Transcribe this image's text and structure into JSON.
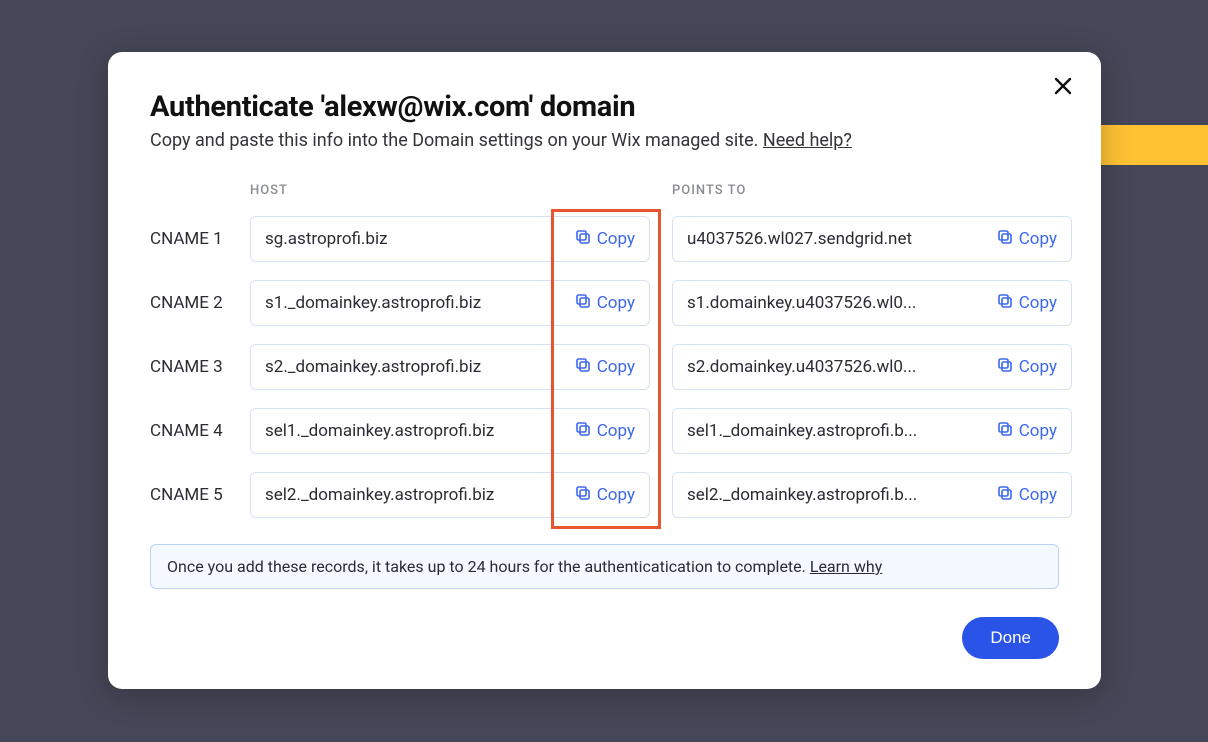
{
  "modal": {
    "title": "Authenticate 'alexw@wix.com' domain",
    "subtitle_prefix": "Copy and paste this info into the Domain settings on your Wix managed site. ",
    "subtitle_link": "Need help?",
    "headers": {
      "host": "HOST",
      "points_to": "POINTS TO"
    },
    "copy_label": "Copy",
    "rows": [
      {
        "label": "CNAME 1",
        "host": "sg.astroprofi.biz",
        "points_to": "u4037526.wl027.sendgrid.net"
      },
      {
        "label": "CNAME 2",
        "host": "s1._domainkey.astroprofi.biz",
        "points_to": "s1.domainkey.u4037526.wl0..."
      },
      {
        "label": "CNAME 3",
        "host": "s2._domainkey.astroprofi.biz",
        "points_to": "s2.domainkey.u4037526.wl0..."
      },
      {
        "label": "CNAME 4",
        "host": "sel1._domainkey.astroprofi.biz",
        "points_to": "sel1._domainkey.astroprofi.b..."
      },
      {
        "label": "CNAME 5",
        "host": "sel2._domainkey.astroprofi.biz",
        "points_to": "sel2._domainkey.astroprofi.b..."
      }
    ],
    "info_prefix": "Once you add these records, it takes up to 24 hours for the authenticatication to complete. ",
    "info_link": "Learn why",
    "done_label": "Done"
  }
}
